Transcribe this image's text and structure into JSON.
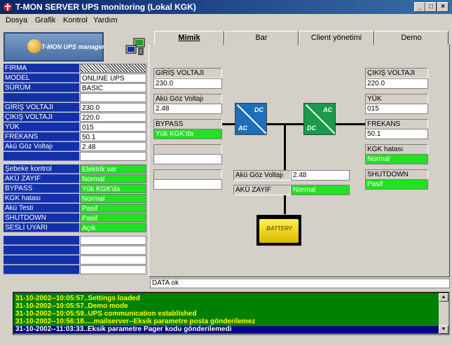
{
  "window": {
    "title": "T-MON SERVER UPS monitoring (Lokal KGK)"
  },
  "menu": [
    "Dosya",
    "Grafik",
    "Kontrol",
    "Yardım"
  ],
  "logo": {
    "text": "T-MON UPS manager"
  },
  "info_rows": [
    {
      "label": "FİRMA",
      "value": ""
    },
    {
      "label": "MODEL",
      "value": "ONLINE UPS"
    },
    {
      "label": "SÜRÜM",
      "value": "BASIC"
    },
    {
      "label": "",
      "value": ""
    },
    {
      "label": "GİRİŞ VOLTAJI",
      "value": "230.0"
    },
    {
      "label": "ÇIKIŞ VOLTAJI",
      "value": "220.0"
    },
    {
      "label": "YÜK",
      "value": "015"
    },
    {
      "label": "FREKANS",
      "value": "50.1"
    },
    {
      "label": "Akü Göz Voltajı",
      "value": "2.48"
    },
    {
      "label": "",
      "value": ""
    },
    {
      "label": "Şebeke kontrol",
      "value": "Elektrik var"
    },
    {
      "label": "AKÜ ZAYIF",
      "value": "Normal"
    },
    {
      "label": "BYPASS",
      "value": "Yük KGK'da"
    },
    {
      "label": "KGK hatası",
      "value": "Normal"
    },
    {
      "label": "Akü Testi",
      "value": "Pasif"
    },
    {
      "label": "SHUTDOWN",
      "value": "Pasif"
    },
    {
      "label": "SESLİ UYARI",
      "value": "Açık"
    },
    {
      "label": "",
      "value": ""
    },
    {
      "label": "",
      "value": ""
    },
    {
      "label": "",
      "value": ""
    },
    {
      "label": "",
      "value": ""
    }
  ],
  "tabs": [
    "Mimik",
    "Bar",
    "Client yönetimi",
    "Demo"
  ],
  "mimic": {
    "input_voltage_label": "GİRİŞ VOLTAJI",
    "input_voltage": "230.0",
    "battery_cell_voltage_label": "Akü Göz Voltajı",
    "battery_cell_voltage": "2.48",
    "bypass_label": "BYPASS",
    "bypass_value": "Yük KGK'da",
    "output_voltage_label": "ÇIKIŞ VOLTAJI",
    "output_voltage": "220.0",
    "load_label": "YÜK",
    "load_value": "015",
    "frequency_label": "FREKANS",
    "frequency_value": "50.1",
    "ups_fault_label": "KGK hatası",
    "ups_fault_value": "Normal",
    "shutdown_label": "SHUTDOWN",
    "shutdown_value": "Pasif",
    "mid_battery_voltage_label": "Akü Göz Voltajı",
    "mid_battery_voltage": "2.48",
    "battery_low_label": "AKÜ ZAYIF",
    "battery_low_value": "Normal",
    "rectifier": {
      "top": "DC",
      "bottom": "AC"
    },
    "inverter": {
      "top": "AC",
      "bottom": "DC"
    },
    "battery_text": "BATTERY"
  },
  "status_text": "DATA ok",
  "log": [
    "31-10-2002--10:05:57..Settings loaded",
    "31-10-2002--10:05:57..Demo mode",
    "31-10-2002--10:05:59..UPS communication established",
    "31-10-2002--10:56:18.....mailserver--Eksik parametre posta gönderilemez",
    "31-10-2002--11:03:33..Eksik parametre Pager kodu gönderilemedi"
  ],
  "colors": {
    "title_bar": "#0a246a",
    "label_blue": "#1230a8",
    "status_green": "#22e022",
    "log_bg": "#008000",
    "log_text": "#ffff00"
  }
}
